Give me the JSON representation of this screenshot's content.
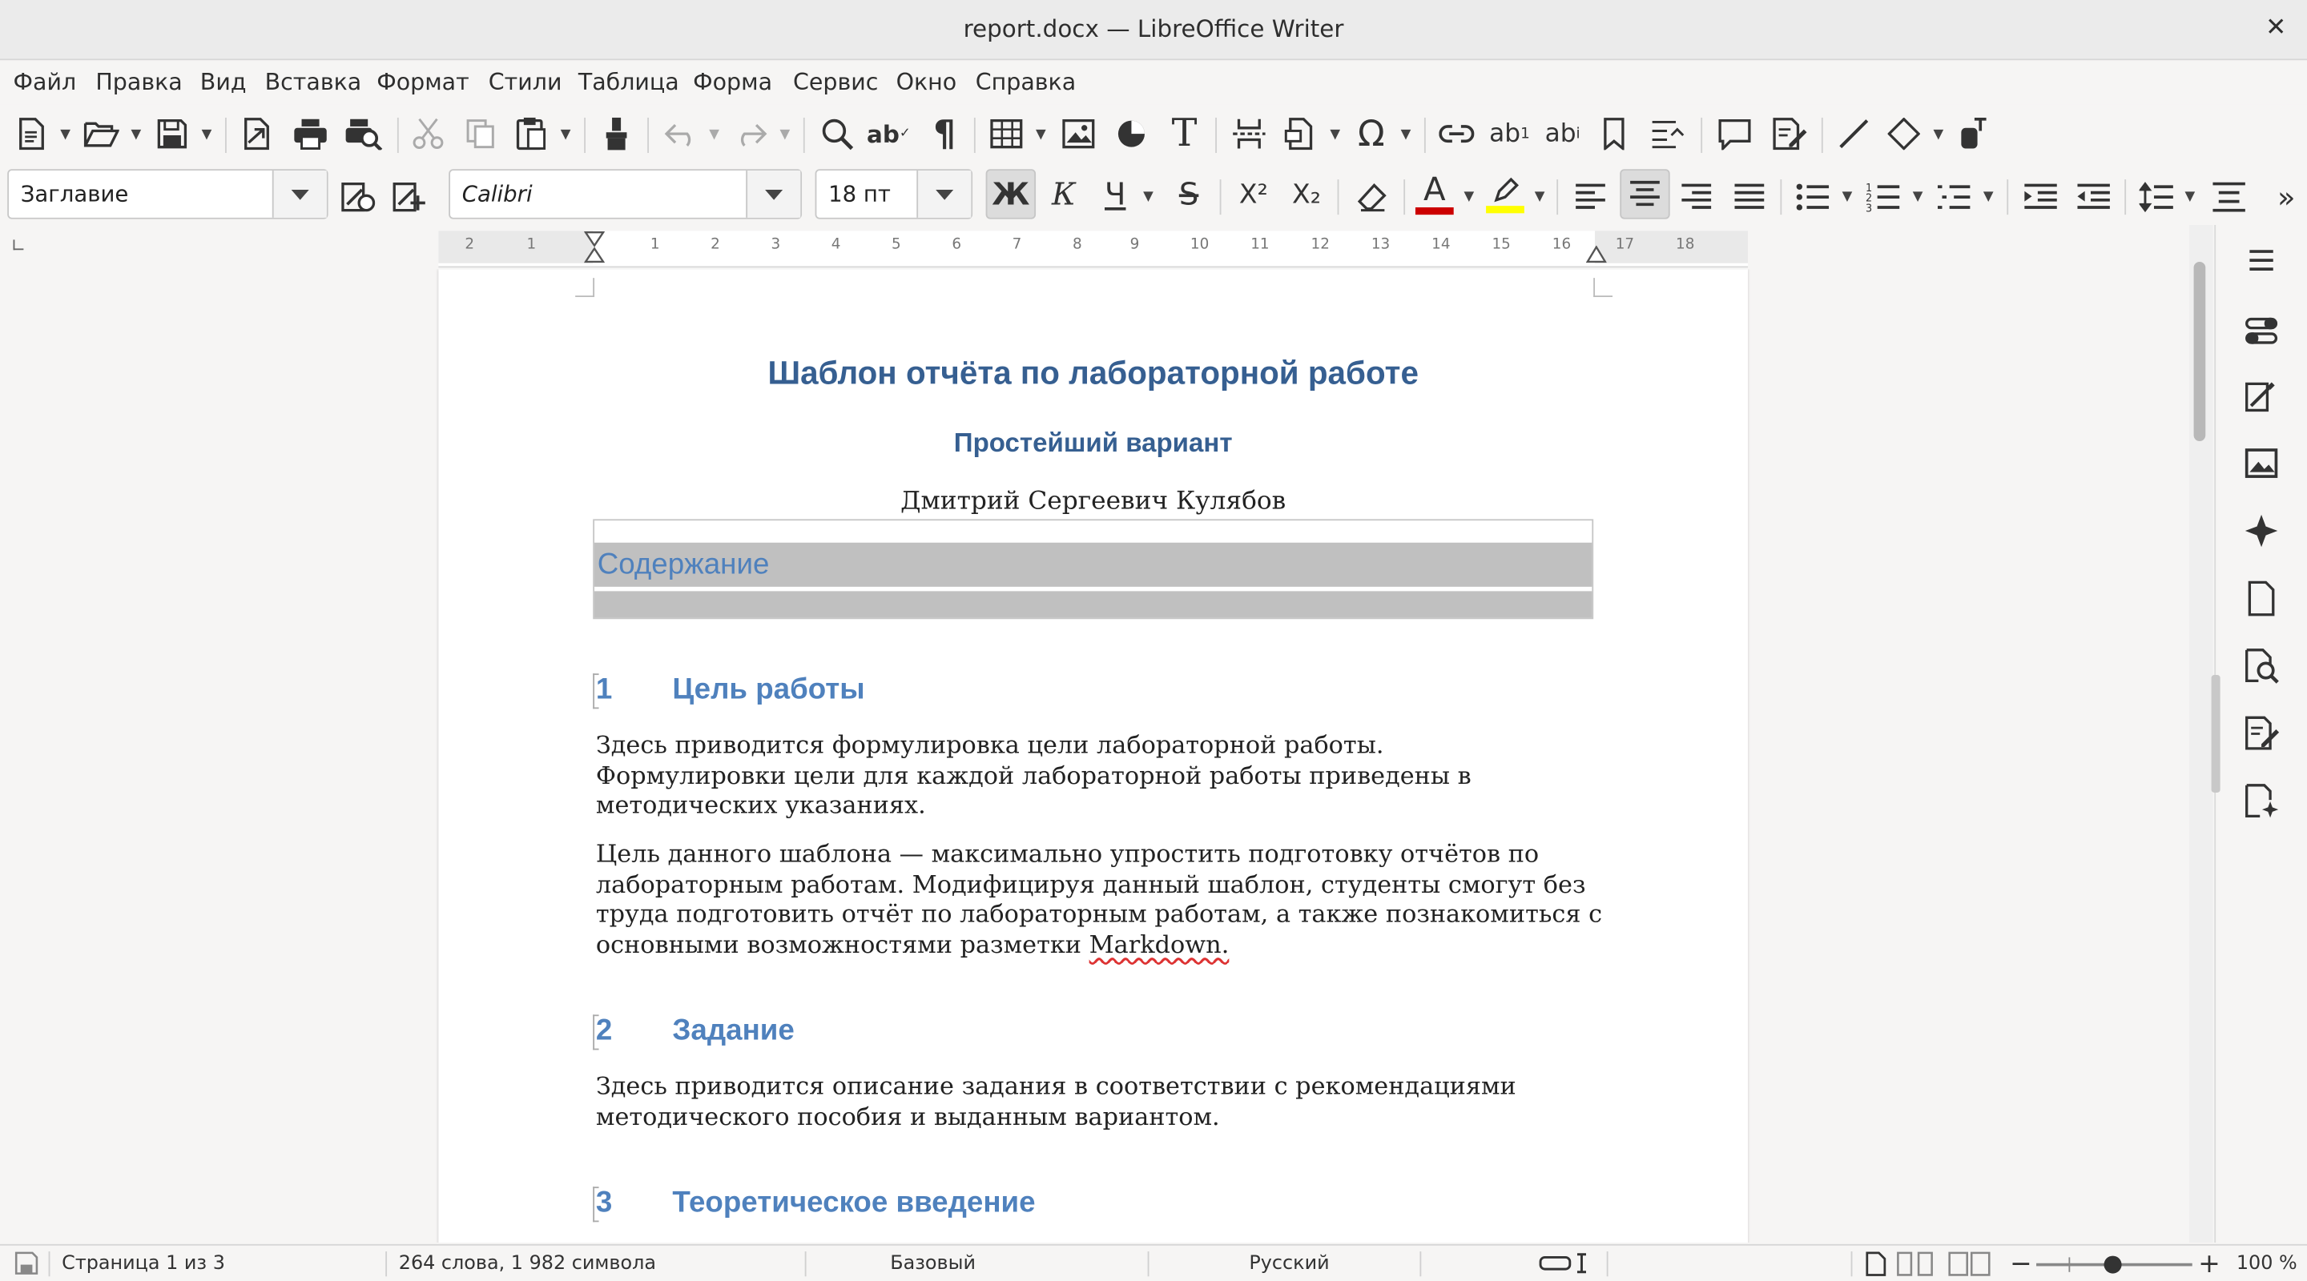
{
  "window": {
    "title": "report.docx — LibreOffice Writer",
    "close": "✕"
  },
  "menu": [
    "Файл",
    "Правка",
    "Вид",
    "Вставка",
    "Формат",
    "Стили",
    "Таблица",
    "Форма",
    "Сервис",
    "Окно",
    "Справка"
  ],
  "format_bar": {
    "paragraph_style": "Заглавие",
    "font_name": "Calibri",
    "font_size": "18 пт",
    "bold": "Ж",
    "italic": "К",
    "underline": "Ч",
    "strikethrough": "S",
    "superscript": "X²",
    "subscript": "X₂",
    "bold_active": true,
    "center_align_active": true,
    "font_color": "#cc0000",
    "highlight_color": "#ffff00",
    "more": "»"
  },
  "ruler": {
    "numbers": [
      "2",
      "1",
      "1",
      "2",
      "3",
      "4",
      "5",
      "6",
      "7",
      "8",
      "9",
      "10",
      "11",
      "12",
      "13",
      "14",
      "15",
      "16",
      "17",
      "18"
    ]
  },
  "document": {
    "title": "Шаблон отчёта по лабораторной работе",
    "subtitle": "Простейший вариант",
    "author": "Дмитрий Сергеевич Кулябов",
    "toc_title": "Содержание",
    "sections": [
      {
        "num": "1",
        "title": "Цель работы"
      },
      {
        "num": "2",
        "title": "Задание"
      },
      {
        "num": "3",
        "title": "Теоретическое введение"
      }
    ],
    "p1": "Здесь приводится формулировка цели лабораторной работы. Формулировки цели для каждой лабораторной работы приведены в методических указаниях.",
    "p2_text": "Цель данного шаблона — максимально упростить подготовку отчётов по лабораторным работам. Модифицируя данный шаблон, студенты смогут без труда подготовить отчёт по лабораторным работам, а также познакомиться с основными возможностями разметки ",
    "p2_word": "Markdown.",
    "p3": "Здесь приводится описание задания в соответствии с рекомендациями методического пособия и выданным вариантом."
  },
  "status": {
    "page": "Страница 1 из 3",
    "words": "264 слова, 1 982 символа",
    "page_style": "Базовый",
    "language": "Русский",
    "zoom": "100 %",
    "zoom_minus": "−",
    "zoom_plus": "+"
  }
}
